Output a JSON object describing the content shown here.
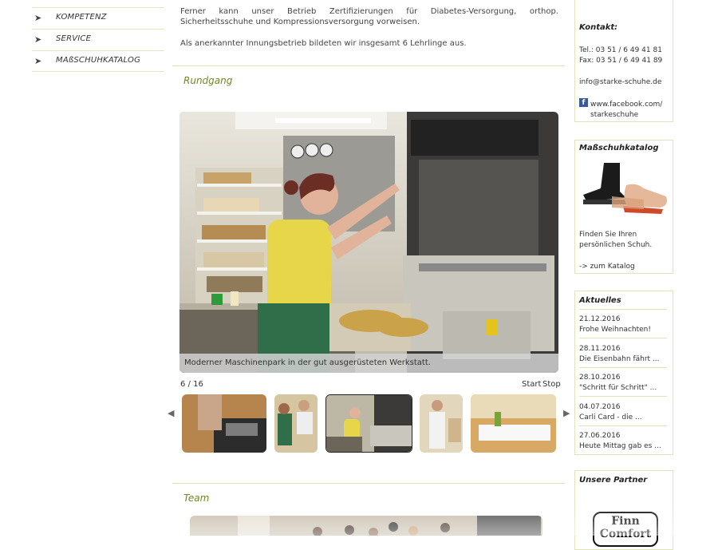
{
  "nav": {
    "items": [
      {
        "label": "KOMPETENZ"
      },
      {
        "label": "SERVICE"
      },
      {
        "label": "MAßSCHUHKATALOG"
      }
    ],
    "arrow_glyph": "➤"
  },
  "main": {
    "paragraphs": [
      "Ferner kann unser Betrieb Zertifizierungen für Diabetes-Versorgung, orthop. Sicherheitsschuhe und Kompressionsversorgung vorweisen.",
      "Als anerkannter Innungsbetrieb bildeten wir insgesamt 6 Lehrlinge aus."
    ],
    "tour": {
      "title": "Rundgang",
      "caption": "Moderner Maschinenpark in der gut ausgerüsteten Werkstatt.",
      "counter": "6 / 16",
      "start_label": "Start",
      "stop_label": "Stop"
    },
    "team": {
      "title": "Team"
    }
  },
  "sidebar": {
    "contact": {
      "title": "Kontakt:",
      "tel": "Tel.: 03 51 / 6 49 41 81",
      "fax": "Fax: 03 51 / 6 49 41 89",
      "email": "info@starke-schuhe.de",
      "facebook_line1": "www.facebook.com/",
      "facebook_line2": "starkeschuhe"
    },
    "catalog": {
      "title": "Maßschuhkatalog",
      "text_line1": "Finden Sie Ihren",
      "text_line2": "persönlichen Schuh.",
      "link": "-> zum Katalog"
    },
    "news": {
      "title": "Aktuelles",
      "items": [
        {
          "date": "21.12.2016",
          "text": "Frohe Weihnachten!"
        },
        {
          "date": "28.11.2016",
          "text": "Die Eisenbahn fährt ..."
        },
        {
          "date": "28.10.2016",
          "text": "\"Schritt für Schritt\" ..."
        },
        {
          "date": "04.07.2016",
          "text": "Carli Card - die ..."
        },
        {
          "date": "27.06.2016",
          "text": "Heute Mittag gab es ..."
        }
      ]
    },
    "partners": {
      "title": "Unsere Partner",
      "logo_line1": "Finn",
      "logo_line2": "Comfort"
    }
  },
  "colors": {
    "accent_green": "#6b8a22",
    "rule_green": "#dfe5b8"
  }
}
